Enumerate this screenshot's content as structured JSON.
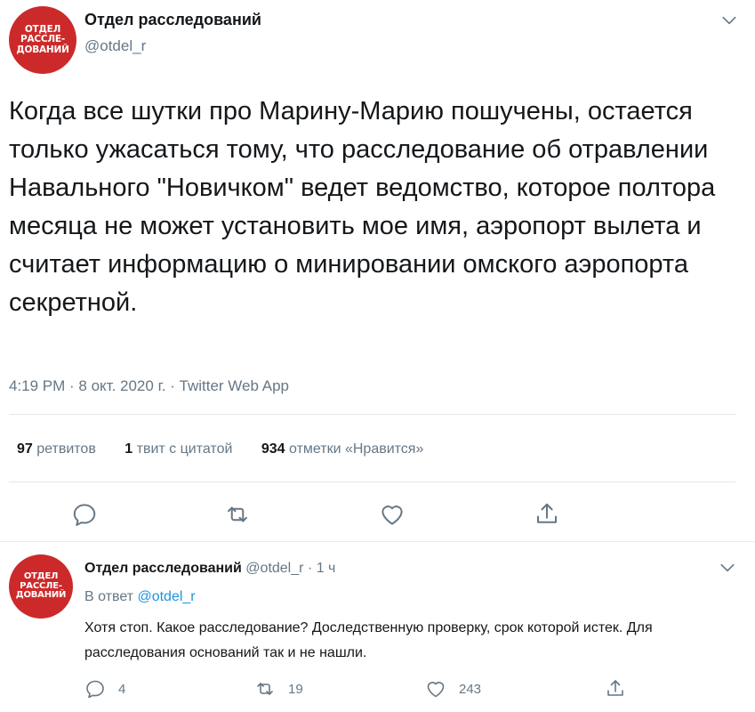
{
  "author": {
    "avatar_lines": [
      "ОТДЕЛ",
      "РАССЛЕ-",
      "ДОВАНИЙ"
    ],
    "name": "Отдел расследований",
    "handle": "@otdel_r"
  },
  "tweet": {
    "text": "Когда все шутки про Марину-Марию пошучены, остается только ужасаться тому, что расследование об отравлении Навального \"Новичком\" ведет ведомство, которое полтора месяца не может установить мое имя, аэропорт вылета и считает информацию о минировании омского аэропорта секретной.",
    "timestamp": "4:19 PM · 8 окт. 2020 г. · Twitter Web App"
  },
  "stats": {
    "retweets_count": "97",
    "retweets_label": "ретвитов",
    "quotes_count": "1",
    "quotes_label": "твит с цитатой",
    "likes_count": "934",
    "likes_label": "отметки «Нравится»"
  },
  "actions": {
    "reply_icon": "reply-icon",
    "retweet_icon": "retweet-icon",
    "like_icon": "heart-icon",
    "share_icon": "share-icon"
  },
  "reply": {
    "author_name": "Отдел расследований",
    "handle": "@otdel_r",
    "dot": "·",
    "time": "1 ч",
    "reply_to_prefix": "В ответ",
    "reply_to_handle": "@otdel_r",
    "text": "Хотя стоп. Какое расследование? Доследственную проверку, срок которой истек. Для расследования оснований так и не нашли.",
    "reply_count": "4",
    "retweet_count": "19",
    "like_count": "243"
  },
  "colors": {
    "avatar_bg": "#cc2a2a",
    "secondary_text": "#657786",
    "link": "#1b95e0",
    "divider": "#e1e8ed"
  }
}
